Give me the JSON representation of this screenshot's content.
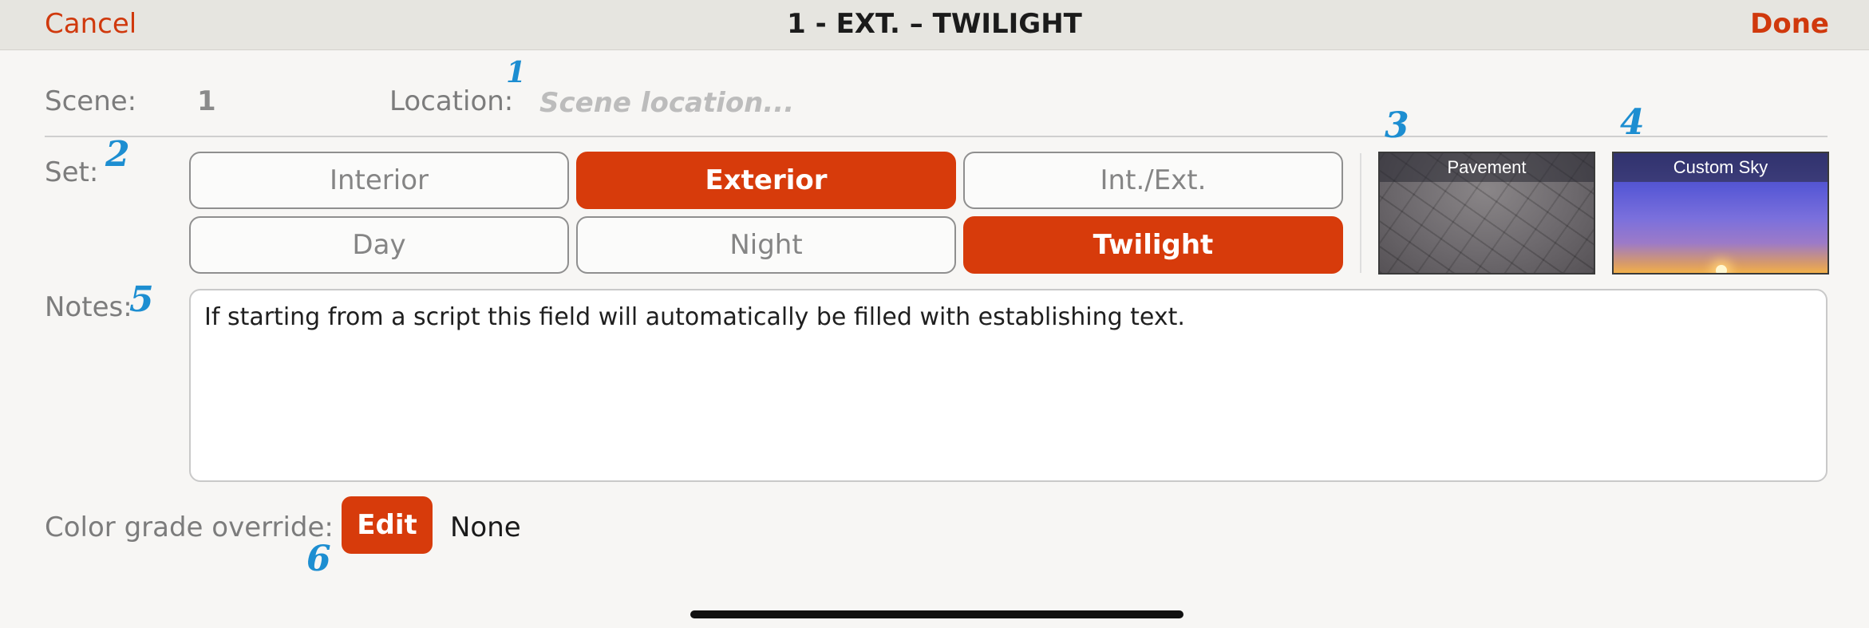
{
  "header": {
    "cancel_label": "Cancel",
    "title": "1 - EXT. – TWILIGHT",
    "done_label": "Done"
  },
  "scene": {
    "label": "Scene:",
    "value": "1"
  },
  "location": {
    "label": "Location:",
    "placeholder": "Scene location..."
  },
  "set": {
    "label": "Set:",
    "space_options": [
      "Interior",
      "Exterior",
      "Int./Ext."
    ],
    "space_selected": "Exterior",
    "time_options": [
      "Day",
      "Night",
      "Twilight"
    ],
    "time_selected": "Twilight"
  },
  "environment": {
    "ground": {
      "label": "Pavement",
      "icon": "pavement-texture"
    },
    "sky": {
      "label": "Custom Sky",
      "icon": "sky-gradient"
    }
  },
  "notes": {
    "label": "Notes:",
    "value": "If starting from a script this field will automatically be filled with establishing text."
  },
  "color_grade": {
    "label": "Color grade override:",
    "edit_label": "Edit",
    "value": "None"
  },
  "annotations": [
    "1",
    "2",
    "3",
    "4",
    "5",
    "6"
  ],
  "colors": {
    "accent": "#d73b0b",
    "annotation": "#1d8ed1"
  }
}
